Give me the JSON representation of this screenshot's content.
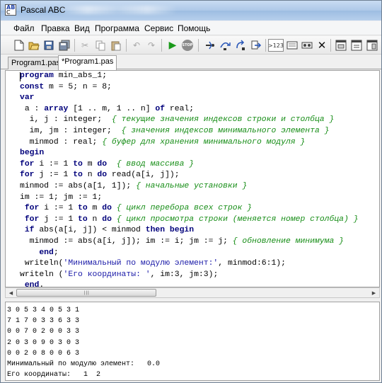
{
  "window": {
    "title": "Pascal ABC"
  },
  "menu": {
    "items": [
      "Файл",
      "Правка",
      "Вид",
      "Программа",
      "Сервис",
      "Помощь"
    ]
  },
  "toolbar": {
    "icons": [
      "new-file-icon",
      "open-folder-icon",
      "save-icon",
      "save-all-icon",
      "cut-icon",
      "copy-icon",
      "paste-icon",
      "undo-icon",
      "redo-icon",
      "run-icon",
      "stop-icon",
      "step-into-icon",
      "step-over-icon",
      "step-out-icon",
      "run-to-cursor-icon",
      "evaluate-icon",
      "watch-icon",
      "breakpoint-icon",
      "clear-icon",
      "window1-icon",
      "window2-icon",
      "window3-icon",
      "window4-icon"
    ],
    "evaluate_label": ">123",
    "stop_label": "STOP"
  },
  "tabs": [
    {
      "label": "Program1.pas"
    },
    {
      "label": "*Program1.pas"
    }
  ],
  "code": [
    [
      {
        "t": "program",
        "k": "kw"
      },
      {
        "t": " min_abs_1;"
      }
    ],
    [
      {
        "t": "const",
        "k": "kw"
      },
      {
        "t": " m = 5; n = 8;"
      }
    ],
    [
      {
        "t": "var",
        "k": "kw"
      }
    ],
    [
      {
        "t": " a : "
      },
      {
        "t": "array",
        "k": "kw"
      },
      {
        "t": " [1 .. m, 1 .. n] "
      },
      {
        "t": "of",
        "k": "kw"
      },
      {
        "t": " real;"
      }
    ],
    [
      {
        "t": "  i, j : integer;  "
      },
      {
        "t": "{ текущие значения индексов строки и столбца }",
        "k": "cm"
      }
    ],
    [
      {
        "t": "  im, jm : integer;  "
      },
      {
        "t": "{ значения индексов минимального элемента }",
        "k": "cm"
      }
    ],
    [
      {
        "t": "  minmod : real; "
      },
      {
        "t": "{ буфер для хранения минимального модуля }",
        "k": "cm"
      }
    ],
    [
      {
        "t": "begin",
        "k": "kw"
      }
    ],
    [
      {
        "t": "for",
        "k": "kw"
      },
      {
        "t": " i := 1 "
      },
      {
        "t": "to",
        "k": "kw"
      },
      {
        "t": " m "
      },
      {
        "t": "do",
        "k": "kw"
      },
      {
        "t": "  "
      },
      {
        "t": "{ ввод массива }",
        "k": "cm"
      }
    ],
    [
      {
        "t": "for",
        "k": "kw"
      },
      {
        "t": " j := 1 "
      },
      {
        "t": "to",
        "k": "kw"
      },
      {
        "t": " n "
      },
      {
        "t": "do",
        "k": "kw"
      },
      {
        "t": " read(a[i, j]);"
      }
    ],
    [
      {
        "t": "minmod := abs(a[1, 1]); "
      },
      {
        "t": "{ начальные установки }",
        "k": "cm"
      }
    ],
    [
      {
        "t": "im := 1; jm := 1;"
      }
    ],
    [
      {
        "t": " "
      },
      {
        "t": "for",
        "k": "kw"
      },
      {
        "t": " i := 1 "
      },
      {
        "t": "to",
        "k": "kw"
      },
      {
        "t": " m "
      },
      {
        "t": "do",
        "k": "kw"
      },
      {
        "t": " "
      },
      {
        "t": "{ цикл перебора всех строк }",
        "k": "cm"
      }
    ],
    [
      {
        "t": " "
      },
      {
        "t": "for",
        "k": "kw"
      },
      {
        "t": " j := 1 "
      },
      {
        "t": "to",
        "k": "kw"
      },
      {
        "t": " n "
      },
      {
        "t": "do",
        "k": "kw"
      },
      {
        "t": " "
      },
      {
        "t": "{ цикл просмотра строки (меняется номер столбца) }",
        "k": "cm"
      }
    ],
    [
      {
        "t": " "
      },
      {
        "t": "if",
        "k": "kw"
      },
      {
        "t": " abs(a[i, j]) < minmod "
      },
      {
        "t": "then",
        "k": "kw"
      },
      {
        "t": " "
      },
      {
        "t": "begin",
        "k": "kw"
      }
    ],
    [
      {
        "t": "  minmod := abs(a[i, j]); im := i; jm := j; "
      },
      {
        "t": "{ обновление минимума }",
        "k": "cm"
      }
    ],
    [
      {
        "t": "    "
      },
      {
        "t": "end",
        "k": "kw"
      },
      {
        "t": ";"
      }
    ],
    [
      {
        "t": " writeln("
      },
      {
        "t": "'Минимальный по модулю элемент:'",
        "k": "st"
      },
      {
        "t": ", minmod:6:1);"
      }
    ],
    [
      {
        "t": "writeln ("
      },
      {
        "t": "'Его координаты: '",
        "k": "st"
      },
      {
        "t": ", im:3, jm:3);"
      }
    ],
    [
      {
        "t": " "
      },
      {
        "t": "end",
        "k": "kw"
      },
      {
        "t": "."
      }
    ]
  ],
  "output": {
    "lines": [
      "3 0 5 3 4 0 5 3 1",
      "7 1 7 0 3 3 6 3 3",
      "0 0 7 0 2 0 0 3 3",
      "2 0 3 0 9 0 3 0 3",
      "0 0 2 0 8 0 0 6 3",
      "Минимальный по модулю элемент:   0.0",
      "Его координаты:   1  2"
    ]
  }
}
